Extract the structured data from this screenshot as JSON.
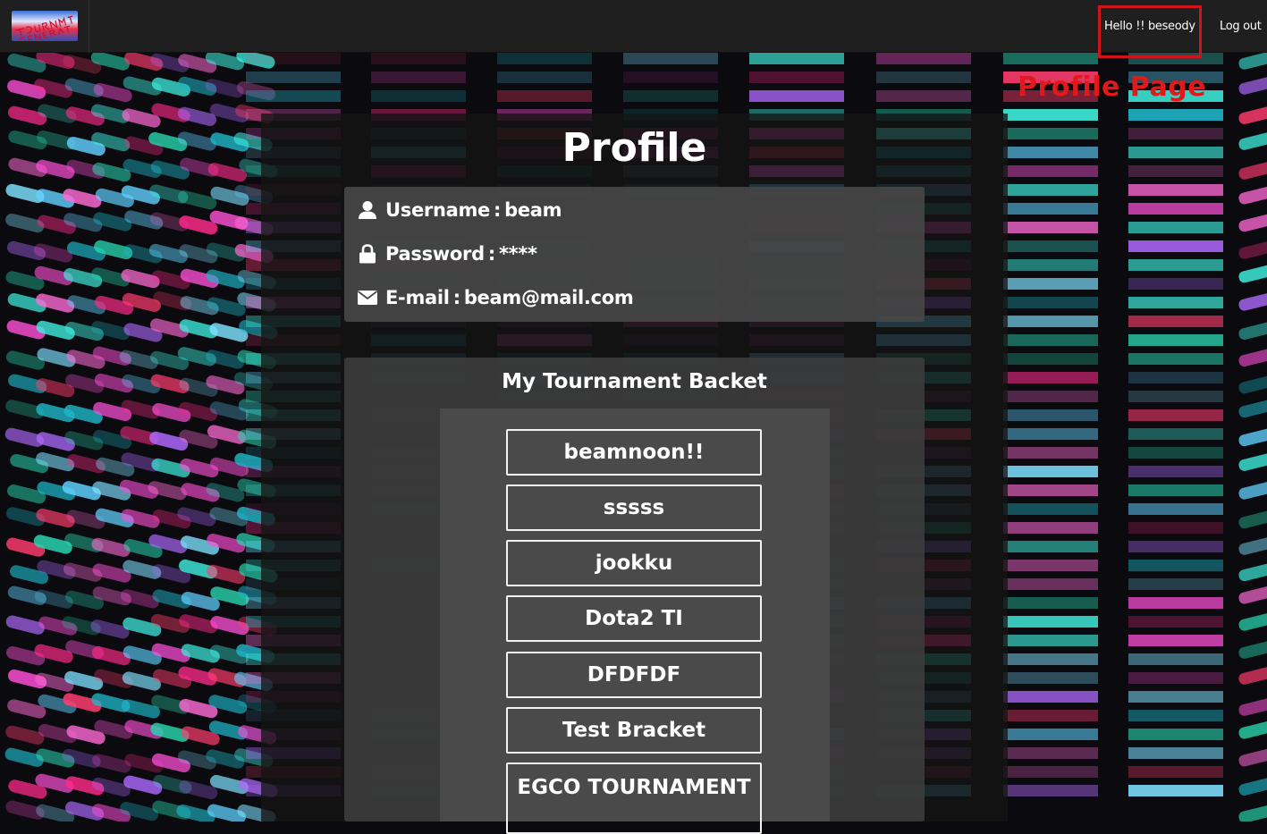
{
  "navbar": {
    "logo_alt": "Tournament Generator",
    "hello_text": "Hello !! beseody",
    "logout_label": "Log out"
  },
  "annotation": "Profile Page",
  "profile": {
    "title": "Profile",
    "username_label": "Username",
    "username_value": "beam",
    "password_label": "Password",
    "password_value": "****",
    "email_label": "E-mail",
    "email_value": "beam@mail.com",
    "separator": ":"
  },
  "brackets": {
    "title": "My Tournament Backet",
    "items": [
      {
        "label": "beamnoon!!"
      },
      {
        "label": "sssss"
      },
      {
        "label": "jookku"
      },
      {
        "label": "Dota2 TI"
      },
      {
        "label": "DFDFDF"
      },
      {
        "label": "Test Bracket"
      },
      {
        "label": "EGCO TOURNAMENT"
      }
    ]
  },
  "icons": {
    "user": "user-icon",
    "lock": "lock-icon",
    "mail": "envelope-icon"
  },
  "colors": {
    "annotation": "#e01a1a",
    "highlight_box": "#d0141c",
    "navbar": "#1f1f1f"
  }
}
